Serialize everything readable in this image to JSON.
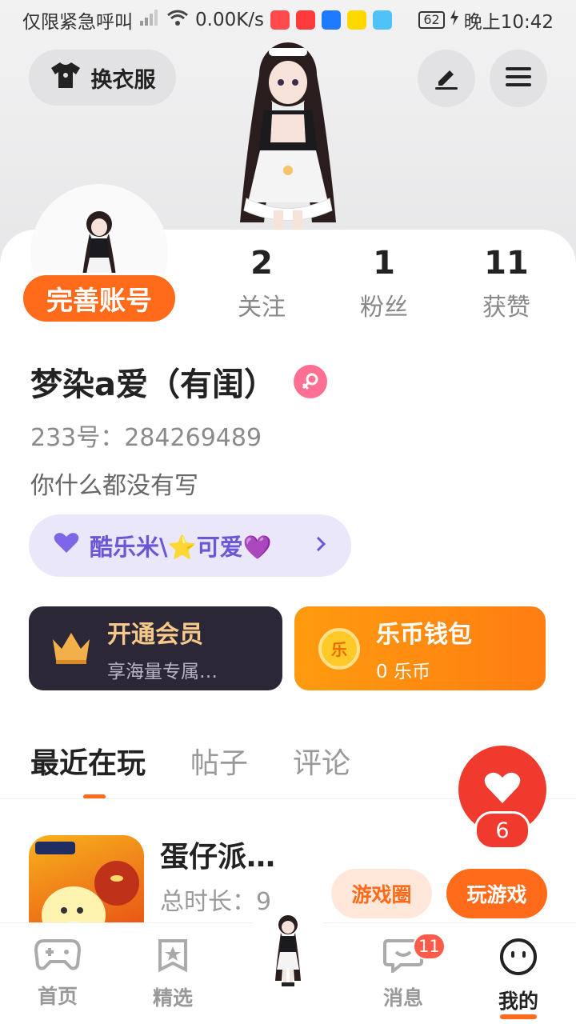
{
  "status_bar": {
    "carrier_text": "仅限紧急呼叫",
    "network_speed": "0.00K/s",
    "battery": "62",
    "time": "晚上10:42"
  },
  "header": {
    "wardrobe_label": "换衣服"
  },
  "profile": {
    "complete_account_label": "完善账号",
    "stats": [
      {
        "value": "2",
        "label": "关注"
      },
      {
        "value": "1",
        "label": "粉丝"
      },
      {
        "value": "11",
        "label": "获赞"
      }
    ],
    "nickname": "梦染a爱（有闺）",
    "id_line": "233号：284269489",
    "bio": "你什么都没有写",
    "tag_text": "酷乐米\\⭐可爱💜"
  },
  "cards": {
    "vip_title": "开通会员",
    "vip_subtitle": "享海量专属…",
    "wallet_title": "乐币钱包",
    "wallet_subtitle": "0 乐币",
    "coin_char": "乐"
  },
  "tabs": [
    "最近在玩",
    "帖子",
    "评论"
  ],
  "recent_game": {
    "title": "蛋仔派…",
    "time": "总时长：9 .",
    "circle_button": "游戏圈",
    "play_button": "玩游戏"
  },
  "like_fab": {
    "count": "6"
  },
  "bottom_nav": {
    "items": [
      "首页",
      "精选",
      "消息",
      "我的"
    ],
    "message_badge": "11"
  },
  "colors": {
    "accent": "#ff6b1a",
    "vip_bg": "#2b2736",
    "wallet_bg": "#ff8a12",
    "like_red": "#f03a2e",
    "tag_bg": "#ebe7fb"
  }
}
